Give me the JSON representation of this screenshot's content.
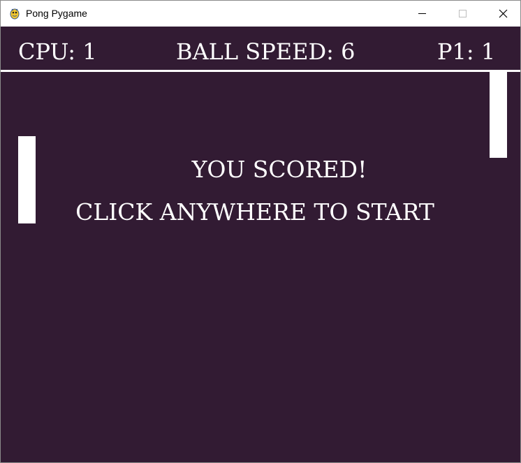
{
  "window": {
    "title": "Pong Pygame",
    "app_icon": "pygame-snake-icon",
    "controls": [
      "minimize-icon",
      "maximize-icon",
      "close-icon"
    ]
  },
  "hud": {
    "cpu_score": "CPU: 1",
    "ball_speed": "BALL SPEED: 6",
    "p1_score": "P1: 1"
  },
  "message": {
    "line1": "YOU SCORED!",
    "line2": "CLICK ANYWHERE TO START"
  },
  "colors": {
    "background": "#321b33",
    "foreground": "#ffffff",
    "paddle": "#ffffff"
  }
}
